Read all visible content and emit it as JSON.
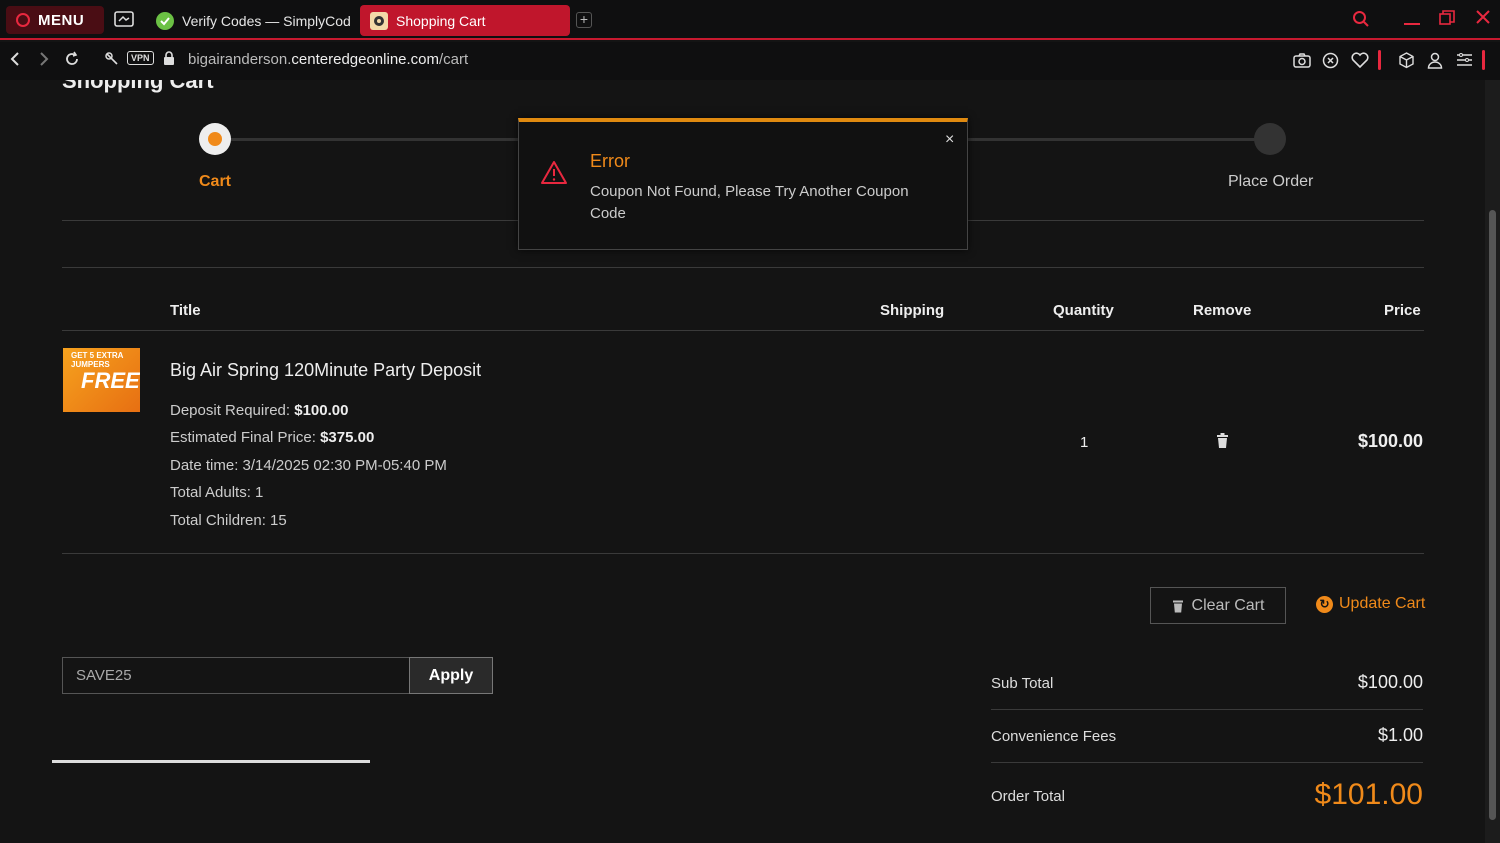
{
  "browser": {
    "menu_label": "MENU",
    "tabs": [
      {
        "title": "Verify Codes — SimplyCodes"
      },
      {
        "title": "Shopping Cart"
      }
    ],
    "url_prefix": "bigairanderson.",
    "url_domain": "centeredgeonline.com",
    "url_path": "/cart",
    "vpn_label": "VPN"
  },
  "page": {
    "title": "Shopping Cart",
    "steps": [
      {
        "label": "Cart",
        "active": true
      },
      {
        "label": "Place Order",
        "active": false
      }
    ],
    "table_headers": {
      "title": "Title",
      "shipping": "Shipping",
      "quantity": "Quantity",
      "remove": "Remove",
      "price": "Price"
    },
    "item": {
      "image_text_top": "GET 5 EXTRA JUMPERS",
      "image_text_main": "FREE",
      "name": "Big Air Spring 120Minute Party Deposit",
      "deposit_label": "Deposit Required: ",
      "deposit_value": "$100.00",
      "estimated_label": "Estimated Final Price: ",
      "estimated_value": "$375.00",
      "datetime": "Date time: 3/14/2025 02:30 PM-05:40 PM",
      "adults": "Total Adults: 1",
      "children": "Total Children: 15",
      "quantity": "1",
      "price": "$100.00"
    },
    "buttons": {
      "clear_cart": "Clear Cart",
      "update_cart": "Update Cart",
      "apply": "Apply"
    },
    "coupon": {
      "value": "SAVE25"
    },
    "summary": {
      "subtotal_label": "Sub Total",
      "subtotal_value": "$100.00",
      "fees_label": "Convenience Fees",
      "fees_value": "$1.00",
      "total_label": "Order Total",
      "total_value": "$101.00"
    }
  },
  "modal": {
    "title": "Error",
    "message": "Coupon Not Found, Please Try Another Coupon Code",
    "close_label": "×"
  },
  "colors": {
    "accent": "#f08a1a",
    "browser_red": "#e8283f",
    "background": "#141414"
  }
}
